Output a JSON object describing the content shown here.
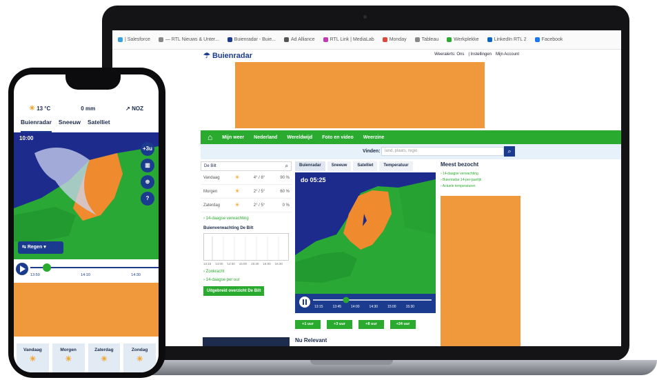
{
  "browser": {
    "bookmarks": [
      {
        "label": "| Salesforce",
        "color": "#3aa0dc"
      },
      {
        "label": "— RTL Nieuws & Unter...",
        "color": "#888888"
      },
      {
        "label": "Buienradar - Buie...",
        "color": "#1b3b8f"
      },
      {
        "label": "Ad Alliance",
        "color": "#555555"
      },
      {
        "label": "RTL Link | MediaLab",
        "color": "#c33ab5"
      },
      {
        "label": "Monday",
        "color": "#e0483a"
      },
      {
        "label": "Tableau",
        "color": "#888888"
      },
      {
        "label": "Werkplekke",
        "color": "#2aab30"
      },
      {
        "label": "LinkedIn RTL 2",
        "color": "#0a66c2"
      },
      {
        "label": "Facebook",
        "color": "#1877f2"
      }
    ]
  },
  "site": {
    "logo": "Buienradar",
    "account": [
      "Weeralerts: Ons",
      "| Instellingen",
      "Mijn Account"
    ],
    "nav": [
      "Mijn weer",
      "Nederland",
      "Wereldwijd",
      "Foto en video",
      "Weerzine"
    ],
    "search_label": "Vinden:",
    "search_placeholder": "land, plaats, regio",
    "location": "De Bilt",
    "days": [
      {
        "name": "Vandaag",
        "temp": "4° / 8°",
        "rain": "90 %"
      },
      {
        "name": "Morgen",
        "temp": "2° / 5°",
        "rain": "60 %"
      },
      {
        "name": "Zaterdag",
        "temp": "2° / 5°",
        "rain": "0 %"
      }
    ],
    "link_14day": "14-daagse verwachting",
    "section_rain": "Buienverwachting De Bilt",
    "chart_ticks": [
      "13:15",
      "14:00",
      "14:30",
      "15:00",
      "15:30",
      "16:00",
      "16:30"
    ],
    "links": [
      "Zonkracht",
      "14-daagse per uur"
    ],
    "cta": "Uitgebreid overzicht De Bilt",
    "map_tabs": [
      "Buienradar",
      "Sneeuw",
      "Satelliet",
      "Temperatuur"
    ],
    "map_time": "do 05:25",
    "player_ticks": [
      "13:15",
      "13:45",
      "14:00",
      "14:30",
      "15:00",
      "15:30"
    ],
    "forecast_buttons": [
      "+1 uur",
      "+3 uur",
      "+8 uur",
      "+24 uur"
    ],
    "news": "Nu Relevant",
    "most_visited": "Meest bezocht",
    "most_visited_links": [
      "14-daagse verwachting",
      "Buienradar 14-per-jaarlijk",
      "Actuele temperaturen"
    ]
  },
  "phone": {
    "top": [
      "13 °C",
      "0 mm",
      "NOZ"
    ],
    "tabs": [
      "Buienradar",
      "Sneeuw",
      "Satelliet"
    ],
    "map_time": "10:00",
    "controls": [
      "+3u",
      "chart-icon",
      "zoom-icon",
      "?"
    ],
    "layer": "Regen",
    "times": [
      "13:50",
      "14:10",
      "14:30"
    ],
    "days": [
      "Vandaag",
      "Morgen",
      "Zaterdag",
      "Zondag"
    ]
  },
  "colors": {
    "accent_green": "#2aab30",
    "brand_blue": "#1b3b8f",
    "ad_orange": "#f0993c",
    "map_blue": "#1c2b8c"
  }
}
